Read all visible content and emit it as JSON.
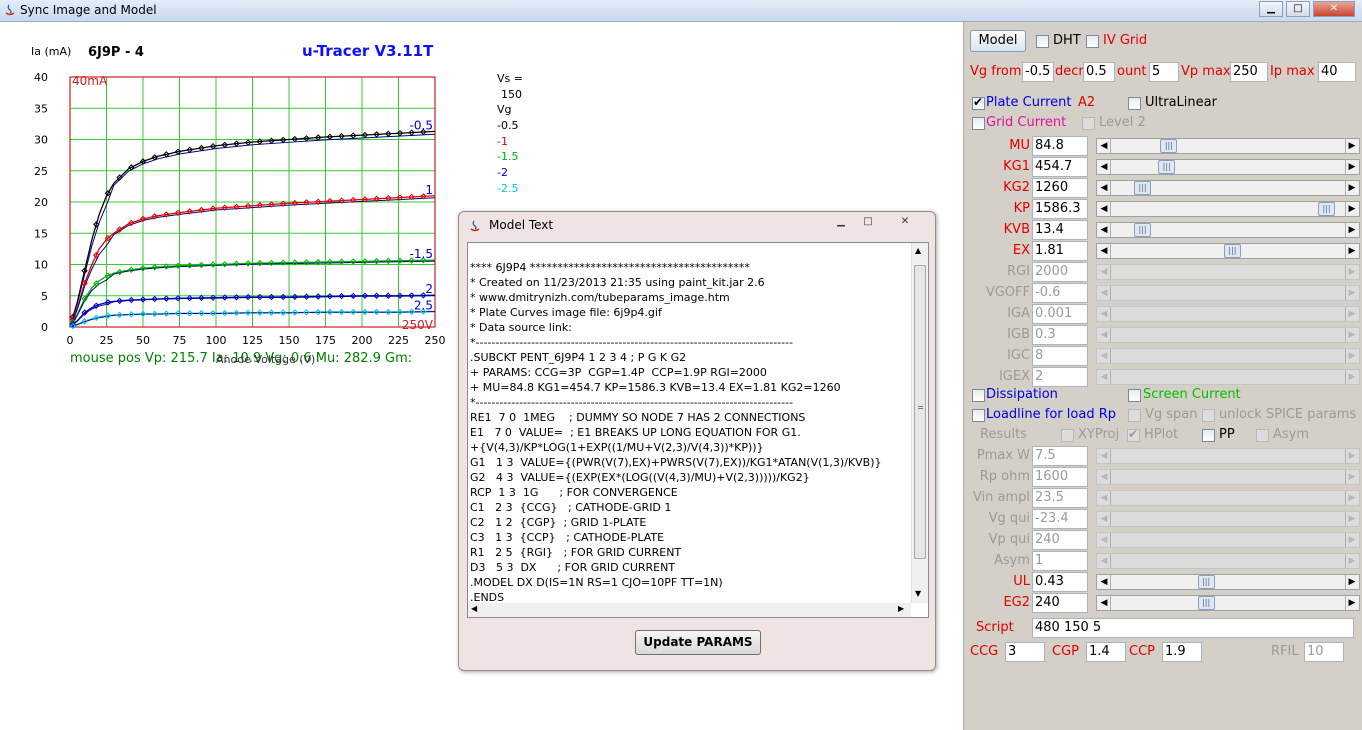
{
  "window": {
    "title": "Sync Image and Model",
    "controls": {
      "minimize": "▁",
      "maximize": "□",
      "close": "✕"
    }
  },
  "graph": {
    "ylabel": "Ia (mA)",
    "tube_id": "6J9P - 4",
    "title": "u-Tracer V3.11T",
    "corner_top_label": "40mA",
    "corner_bottom_label": "250V",
    "xlabel": "Anode Voltage (V)",
    "mouse_pos": "mouse pos Vp: 215.7  Ia: 10.9  Vg: 0.6      Mu: 282.9  Gm:",
    "legend": {
      "vs_label": "Vs =",
      "vs_value": "150",
      "vg_label": "Vg",
      "entries": [
        {
          "text": "-0.5",
          "color": "#000000"
        },
        {
          "text": "-1",
          "color": "#e00000"
        },
        {
          "text": "-1.5",
          "color": "#00b000"
        },
        {
          "text": "-2",
          "color": "#0000cc"
        },
        {
          "text": "-2.5",
          "color": "#00c8e0"
        }
      ]
    }
  },
  "chart_data": {
    "type": "line",
    "xlabel": "Anode Voltage (V)",
    "ylabel": "Ia (mA)",
    "xlim": [
      0,
      250
    ],
    "ylim": [
      0,
      40
    ],
    "xticks": [
      0,
      25,
      50,
      75,
      100,
      125,
      150,
      175,
      200,
      225,
      250
    ],
    "yticks": [
      0,
      5,
      10,
      15,
      20,
      25,
      30,
      35,
      40
    ],
    "grid": true,
    "x": [
      0,
      5,
      10,
      15,
      20,
      25,
      30,
      40,
      50,
      60,
      75,
      100,
      125,
      150,
      175,
      200,
      225,
      250
    ],
    "series": [
      {
        "name": "-0.5",
        "color": "#000000",
        "curve_label": "-0.5",
        "values": [
          0,
          4,
          9,
          14,
          18,
          21,
          23,
          25.3,
          26.5,
          27.3,
          28.1,
          29,
          29.6,
          30,
          30.4,
          30.7,
          31,
          31.3
        ]
      },
      {
        "name": "-1",
        "color": "#e00000",
        "curve_label": "1",
        "values": [
          0,
          3,
          7,
          10,
          12.5,
          14,
          15,
          16.5,
          17.3,
          17.8,
          18.3,
          19,
          19.4,
          19.8,
          20.1,
          20.4,
          20.7,
          21
        ]
      },
      {
        "name": "-1.5",
        "color": "#00b000",
        "curve_label": "-1.5",
        "values": [
          0,
          2,
          4.5,
          6.3,
          7.4,
          8.1,
          8.6,
          9.1,
          9.4,
          9.6,
          9.8,
          10,
          10.2,
          10.3,
          10.4,
          10.5,
          10.6,
          10.7
        ]
      },
      {
        "name": "-2",
        "color": "#0000cc",
        "curve_label": "2",
        "values": [
          0,
          1,
          2.3,
          3.1,
          3.6,
          3.9,
          4.1,
          4.3,
          4.4,
          4.5,
          4.6,
          4.7,
          4.8,
          4.8,
          4.9,
          5,
          5,
          5.1
        ]
      },
      {
        "name": "-2.5",
        "color": "#00c8e0",
        "curve_label": "2.5",
        "values": [
          0,
          0.4,
          0.9,
          1.3,
          1.6,
          1.8,
          1.9,
          2,
          2.1,
          2.1,
          2.2,
          2.2,
          2.3,
          2.3,
          2.4,
          2.4,
          2.4,
          2.5
        ]
      }
    ]
  },
  "dialog": {
    "title": "Model Text",
    "lines": [
      "**** 6J9P4 ****************************************",
      "* Created on 11/23/2013 21:35 using paint_kit.jar 2.6",
      "* www.dmitrynizh.com/tubeparams_image.htm",
      "* Plate Curves image file: 6j9p4.gif",
      "* Data source link:",
      "*--------------------------------------------------------------------------------",
      ".SUBCKT PENT_6J9P4 1 2 3 4 ; P G K G2",
      "+ PARAMS: CCG=3P  CGP=1.4P  CCP=1.9P RGI=2000",
      "+ MU=84.8 KG1=454.7 KP=1586.3 KVB=13.4 EX=1.81 KG2=1260",
      "*--------------------------------------------------------------------------------",
      "RE1  7 0  1MEG    ; DUMMY SO NODE 7 HAS 2 CONNECTIONS",
      "E1   7 0  VALUE=  ; E1 BREAKS UP LONG EQUATION FOR G1.",
      "+{V(4,3)/KP*LOG(1+EXP((1/MU+V(2,3)/V(4,3))*KP))}",
      "G1   1 3  VALUE={(PWR(V(7),EX)+PWRS(V(7),EX))/KG1*ATAN(V(1,3)/KVB)}",
      "G2   4 3  VALUE={(EXP(EX*(LOG((V(4,3)/MU)+V(2,3)))))/KG2}",
      "RCP  1 3  1G      ; FOR CONVERGENCE",
      "C1   2 3  {CCG}   ; CATHODE-GRID 1",
      "C2   1 2  {CGP}  ; GRID 1-PLATE",
      "C3   1 3  {CCP}   ; CATHODE-PLATE",
      "R1   2 5  {RGI}   ; FOR GRID CURRENT",
      "D3   5 3  DX      ; FOR GRID CURRENT",
      ".MODEL DX D(IS=1N RS=1 CJO=10PF TT=1N)",
      ".ENDS",
      "*$"
    ],
    "update_button": "Update PARAMS"
  },
  "panel": {
    "model_button": "Model",
    "dht": "DHT",
    "iv_grid": "IV Grid",
    "vg_from_label": "Vg from",
    "vg_from": "-0.5",
    "decr_label": "decr",
    "decr": "0.5",
    "count_label": "ount",
    "count": "5",
    "vp_max_label": "Vp max",
    "vp_max": "250",
    "ip_max_label": "Ip max",
    "ip_max": "40",
    "plate_current": "Plate Current",
    "a2": "A2",
    "ultralinear": "UltraLinear",
    "grid_current": "Grid Current",
    "level2": "Level 2",
    "params": [
      {
        "label": "MU",
        "value": "84.8",
        "enabled": true,
        "level": 0.23
      },
      {
        "label": "KG1",
        "value": "454.7",
        "enabled": true,
        "level": 0.22
      },
      {
        "label": "KG2",
        "value": "1260",
        "enabled": true,
        "level": 0.11
      },
      {
        "label": "KP",
        "value": "1586.3",
        "enabled": true,
        "level": 0.95
      },
      {
        "label": "KVB",
        "value": "13.4",
        "enabled": true,
        "level": 0.11
      },
      {
        "label": "EX",
        "value": "1.81",
        "enabled": true,
        "level": 0.52
      },
      {
        "label": "RGI",
        "value": "2000",
        "enabled": false
      },
      {
        "label": "VGOFF",
        "value": "-0.6",
        "enabled": false
      },
      {
        "label": "IGA",
        "value": "0.001",
        "enabled": false
      },
      {
        "label": "IGB",
        "value": "0.3",
        "enabled": false
      },
      {
        "label": "IGC",
        "value": "8",
        "enabled": false
      },
      {
        "label": "IGEX",
        "value": "2",
        "enabled": false
      }
    ],
    "dissipation": "Dissipation",
    "screen_current": "Screen Current",
    "loadline": "Loadline for load Rp",
    "vg_span": "Vg span",
    "unlock_spice": "unlock SPICE params",
    "results": "Results",
    "xyproj": "XYProj",
    "hplot": "HPlot",
    "pp": "PP",
    "asym": "Asym",
    "results_params": [
      {
        "label": "Pmax W",
        "value": "7.5"
      },
      {
        "label": "Rp ohm",
        "value": "1600"
      },
      {
        "label": "Vin ampl",
        "value": "23.5"
      },
      {
        "label": "Vg qui",
        "value": "-23.4"
      },
      {
        "label": "Vp qui",
        "value": "240"
      },
      {
        "label": "Asym",
        "value": "1"
      }
    ],
    "ul_label": "UL",
    "ul_value": "0.43",
    "ul_level": 0.4,
    "eg2_label": "EG2",
    "eg2_value": "240",
    "eg2_level": 0.4,
    "script_label": "Script",
    "script_value": "480 150 5",
    "ccg_label": "CCG",
    "ccg": "3",
    "cgp_label": "CGP",
    "cgp": "1.4",
    "ccp_label": "CCP",
    "ccp": "1.9",
    "rfil_label": "RFIL",
    "rfil": "10"
  }
}
